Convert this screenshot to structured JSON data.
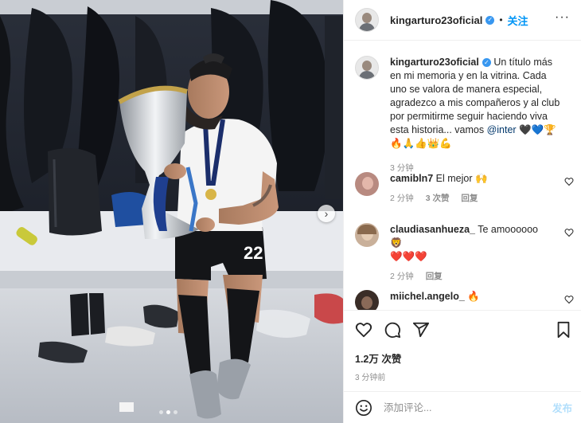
{
  "post": {
    "username": "kingarturo23oficial",
    "follow_label": "关注",
    "separator": "•",
    "more_label": "···",
    "slider_next": "›",
    "caption_text": " Un título más en mi memoria y en la vitrina. Cada uno se valora de manera especial, agradezco a mis compañeros y al club por permitirme seguir haciendo viva esta historia... vamos ",
    "caption_mention": "@inter",
    "caption_emojis": " 🖤💙🏆🔥🙏👍👑💪",
    "caption_time": "3 分钟",
    "likes": "1.2万 次赞",
    "post_time": "3 分钟前",
    "add_comment_placeholder": "添加评论...",
    "post_button": "发布",
    "jersey_number": "22"
  },
  "comments": [
    {
      "username": "camibln7",
      "text": " El mejor 🙌",
      "time": "2 分钟",
      "likes": "3 次赞",
      "reply": "回复"
    },
    {
      "username": "claudiasanhueza_",
      "text": " Te amoooooo 🦁",
      "text2": "❤️❤️❤️",
      "time": "2 分钟",
      "reply": "回复"
    },
    {
      "username": "miichel.angelo_",
      "text": " 🔥"
    }
  ],
  "icons": [
    "verified-icon",
    "more-icon",
    "heart-icon",
    "comment-icon",
    "share-icon",
    "save-icon",
    "emoji-icon",
    "slider-next-icon"
  ],
  "colors": {
    "accent": "#0095f6",
    "verified": "#3897f0",
    "muted": "#8e8e8e",
    "link": "#00376b",
    "post_disabled": "#b2dffc"
  },
  "carousel": {
    "slides": 3,
    "active": 2
  }
}
